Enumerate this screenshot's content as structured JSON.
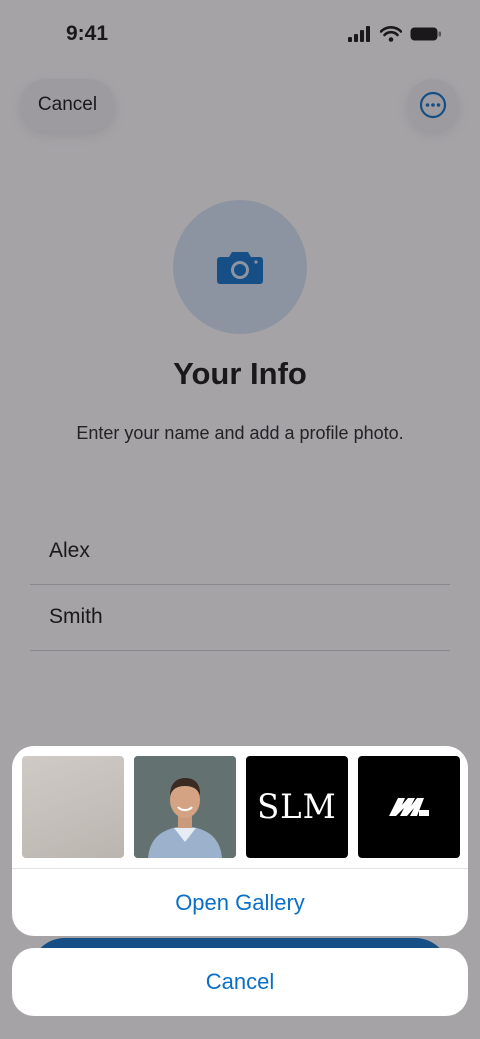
{
  "status_bar": {
    "time": "9:41"
  },
  "header": {
    "cancel_label": "Cancel"
  },
  "profile": {
    "title": "Your Info",
    "subtitle": "Enter your name and add a profile photo."
  },
  "form": {
    "first_name": "Alex",
    "last_name": "Smith"
  },
  "photo_sheet": {
    "thumbnails": [
      {
        "kind": "blurred-photo"
      },
      {
        "kind": "portrait-photo"
      },
      {
        "kind": "logo",
        "text": "SLM"
      },
      {
        "kind": "logo-mark"
      }
    ],
    "open_gallery_label": "Open Gallery",
    "cancel_label": "Cancel"
  },
  "colors": {
    "accent": "#0a6fc6",
    "avatar_bg": "#d6e6f6",
    "overlay": "rgba(40,36,44,0.42)"
  }
}
